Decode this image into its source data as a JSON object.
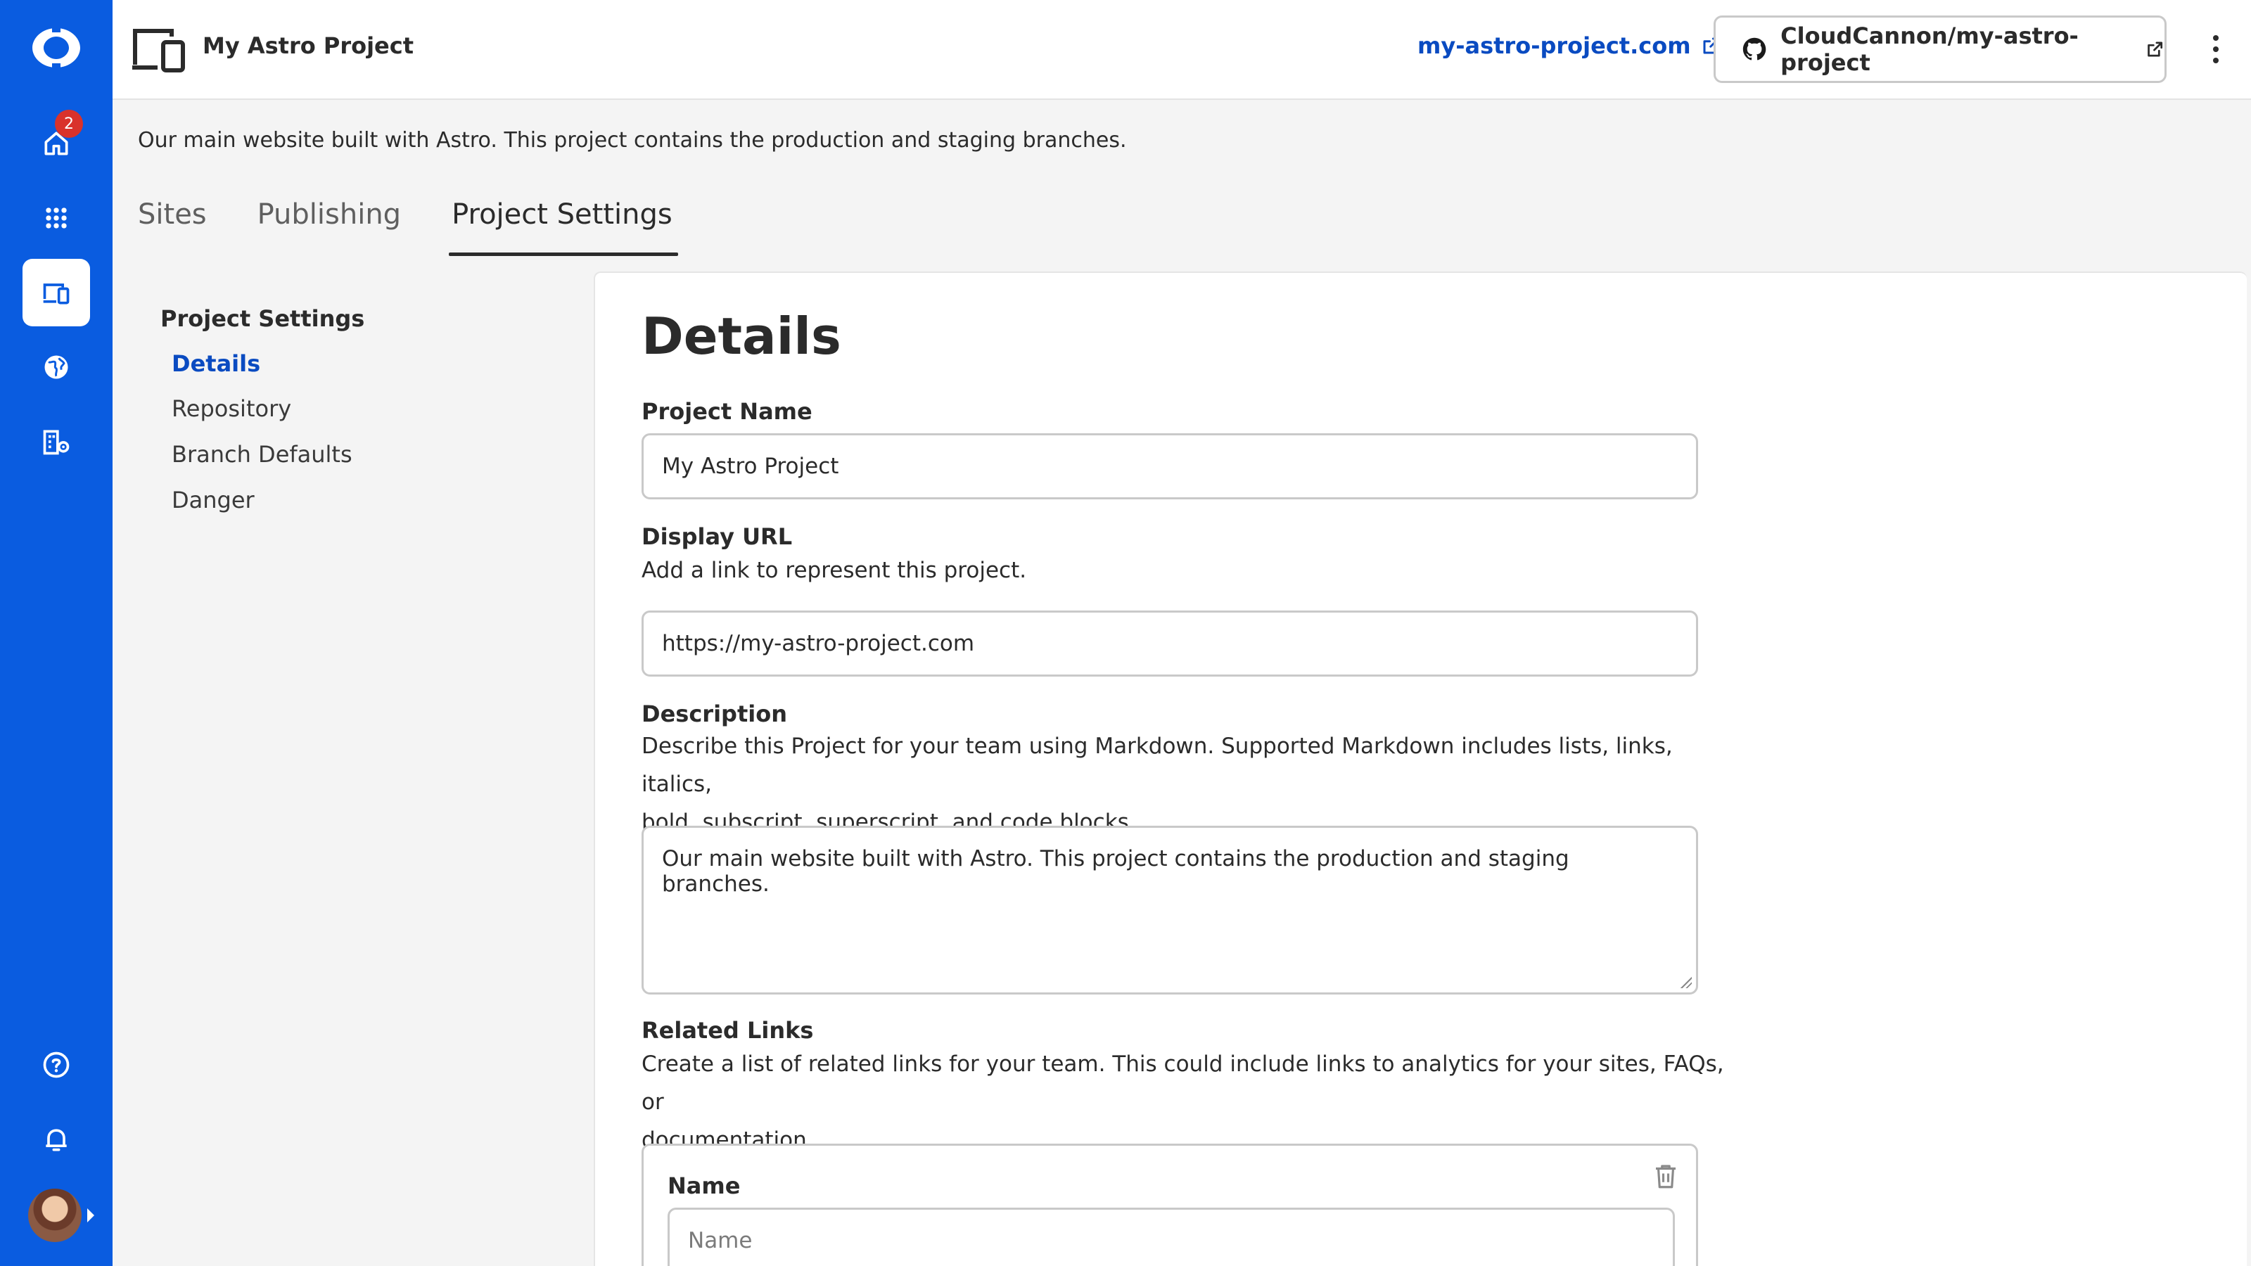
{
  "rail": {
    "notifications_badge": "2",
    "items": [
      {
        "icon": "home-icon"
      },
      {
        "icon": "apps-grid-icon"
      },
      {
        "icon": "projects-icon"
      },
      {
        "icon": "globe-icon"
      },
      {
        "icon": "organisation-settings-icon"
      },
      {
        "icon": "help-icon"
      },
      {
        "icon": "bell-icon"
      }
    ],
    "accent": "#0a5ce0"
  },
  "header": {
    "project_title": "My Astro Project",
    "site_link": "my-astro-project.com",
    "repo_button": "CloudCannon/my-astro-project"
  },
  "subheader": {
    "description": "Our main website built with Astro. This project contains the production and staging branches.",
    "tabs": [
      {
        "label": "Sites"
      },
      {
        "label": "Publishing"
      },
      {
        "label": "Project Settings",
        "active": true
      }
    ]
  },
  "settings_nav": {
    "title": "Project Settings",
    "items": [
      {
        "label": "Details",
        "active": true
      },
      {
        "label": "Repository"
      },
      {
        "label": "Branch Defaults"
      },
      {
        "label": "Danger"
      }
    ]
  },
  "details": {
    "heading": "Details",
    "project_name": {
      "label": "Project Name",
      "value": "My Astro Project"
    },
    "display_url": {
      "label": "Display URL",
      "help": "Add a link to represent this project.",
      "value": "https://my-astro-project.com"
    },
    "description": {
      "label": "Description",
      "help_line1": "Describe this Project for your team using Markdown. Supported Markdown includes lists, links, italics,",
      "help_line2": "bold, subscript, superscript, and code blocks.",
      "value": "Our main website built with Astro. This project contains the production and staging branches."
    },
    "related_links": {
      "label": "Related Links",
      "help_line1": "Create a list of related links for your team. This could include links to analytics for your sites, FAQs, or",
      "help_line2": "documentation.",
      "card": {
        "name_label": "Name",
        "name_placeholder": "Name"
      }
    }
  }
}
